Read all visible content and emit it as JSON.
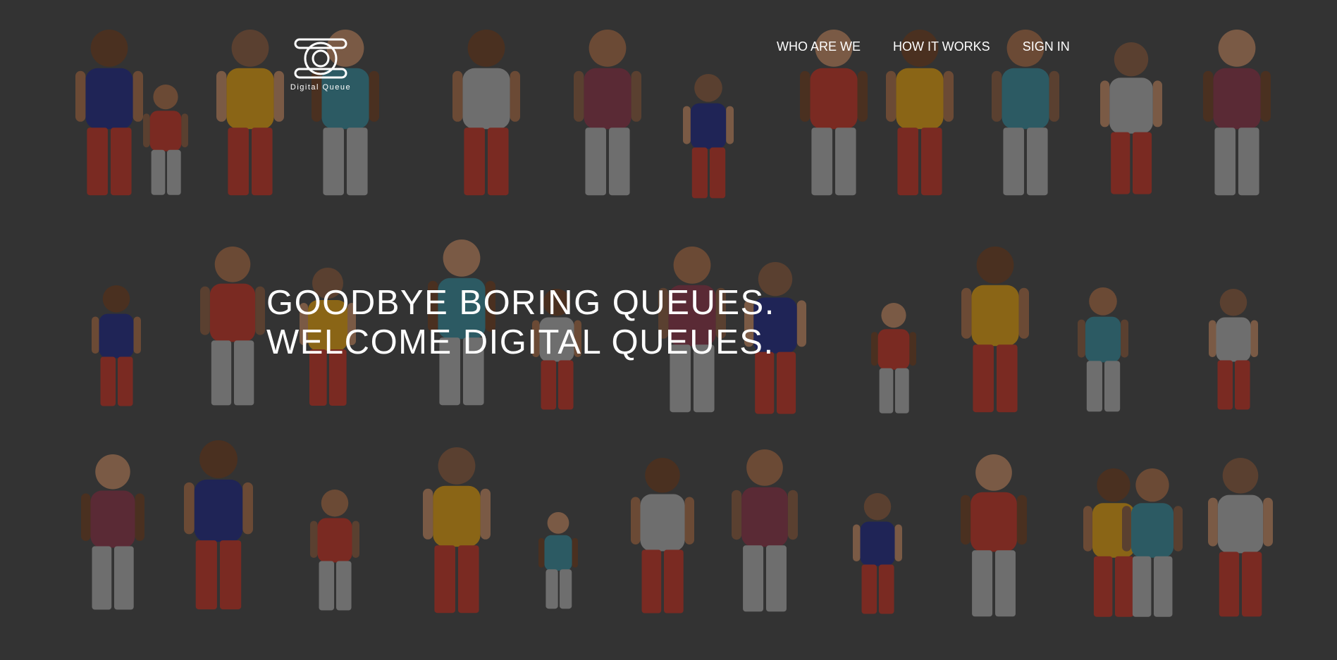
{
  "brand": {
    "name": "Digital Queue",
    "logo_icon": "queue-loop-logo-icon"
  },
  "nav": [
    {
      "label": "WHO ARE WE"
    },
    {
      "label": "HOW IT WORKS"
    },
    {
      "label": "SIGN IN"
    }
  ],
  "hero": {
    "line1": "GOODBYE BORING QUEUES.",
    "line2": "WELCOME DIGITAL QUEUES."
  },
  "colors": {
    "background": "#333333",
    "text": "#ffffff",
    "people_palette": [
      "#1f2456",
      "#7a2a22",
      "#8a6516",
      "#2c5a63",
      "#6e6e6e",
      "#5a2a35"
    ]
  }
}
